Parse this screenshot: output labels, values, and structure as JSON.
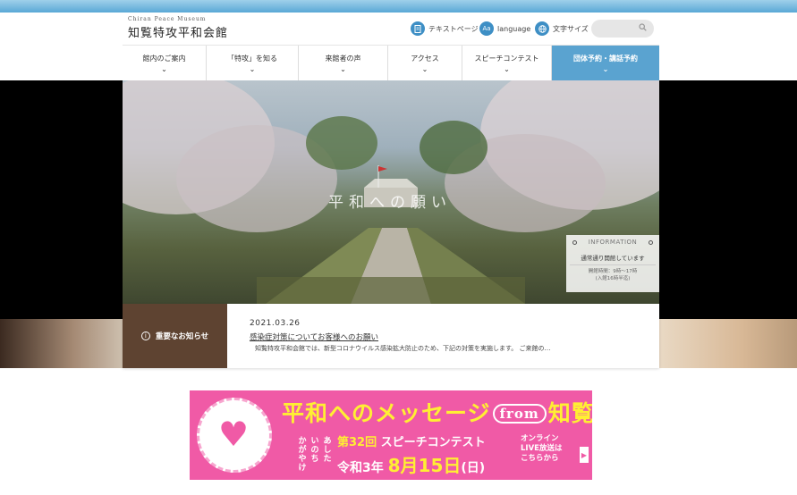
{
  "header": {
    "logo_en": "Chiran Peace Museum",
    "logo_ja": "知覧特攻平和会館",
    "util": [
      {
        "label": "テキストページ",
        "icon": "document-icon"
      },
      {
        "label": "language",
        "icon": "language-icon"
      },
      {
        "label": "文字サイズ",
        "icon": "text-size-icon"
      }
    ],
    "search_icon": "search-icon"
  },
  "nav": {
    "items": [
      {
        "label": "館内のご案内"
      },
      {
        "label": "「特攻」を知る"
      },
      {
        "label": "来館者の声"
      },
      {
        "label": "アクセス"
      },
      {
        "label": "スピーチコンテスト"
      },
      {
        "label": "団体予約・講話予約"
      }
    ],
    "highlight_color": "#5aa3d0"
  },
  "hero": {
    "title": "平和への願い"
  },
  "info": {
    "heading": "INFORMATION",
    "status": "通常通り開館しています",
    "hours_line1": "開館時間：9時～17時",
    "hours_line2": "(入館16時半迄)"
  },
  "news": {
    "label": "重要なお知らせ",
    "date": "2021.03.26",
    "link": "感染症対策についてお客様へのお願い",
    "body": "知覧特攻平和会館では、新型コロナウイルス感染拡大防止のため、下記の対策を実施します。 ご来館の…",
    "label_color": "#5e4331"
  },
  "banner": {
    "title_a": "平和へのメッセージ",
    "title_from": "from",
    "title_b": "知覧",
    "vert1": "あした",
    "vert2": "いのち",
    "vert3": "かがやけ",
    "sub_num": "第32回",
    "sub_text": "スピーチコンテスト",
    "date_pre": "令和3年",
    "date_big": "8月15日",
    "date_post": "(日)",
    "live_1": "オンライン",
    "live_2": "LIVE放送は",
    "live_3": "こちらから",
    "bg_color": "#f05aa6",
    "accent_color": "#ffef33"
  }
}
